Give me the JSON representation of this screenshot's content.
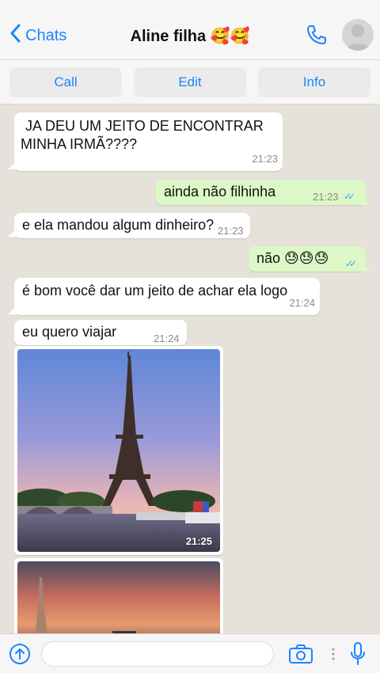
{
  "header": {
    "back_label": "Chats",
    "title": "Aline filha 🥰🥰"
  },
  "actions": {
    "call": "Call",
    "edit": "Edit",
    "info": "Info"
  },
  "messages": [
    {
      "dir": "in",
      "text_lines": [
        "JA DEU UM JEITO DE ENCONTRAR",
        "MINHA IRMÃ????"
      ],
      "time": "21:23"
    },
    {
      "dir": "out",
      "text": "ainda não filhinha",
      "time": "21:23",
      "status": "read"
    },
    {
      "dir": "in",
      "text": "e ela mandou algum dinheiro?",
      "time": "21:23"
    },
    {
      "dir": "out",
      "text": "não 😓😓😓",
      "status": "read"
    },
    {
      "dir": "in",
      "text": "é bom você dar um jeito de achar ela logo",
      "time": "21:24"
    },
    {
      "dir": "in",
      "text": "eu quero viajar",
      "time": "21:24"
    },
    {
      "dir": "in",
      "type": "image",
      "time": "21:25"
    },
    {
      "dir": "in",
      "type": "image"
    }
  ],
  "colors": {
    "accent": "#1a84ff",
    "incoming_bubble": "#ffffff",
    "outgoing_bubble": "#dcf8c6",
    "wallpaper": "#e6e1da",
    "read_ticks": "#4fa3e0"
  },
  "icons": {
    "back": "chevron-left-icon",
    "phone": "phone-icon",
    "avatar": "avatar-icon",
    "attach": "upload-icon",
    "camera": "camera-icon",
    "mic": "microphone-icon"
  }
}
